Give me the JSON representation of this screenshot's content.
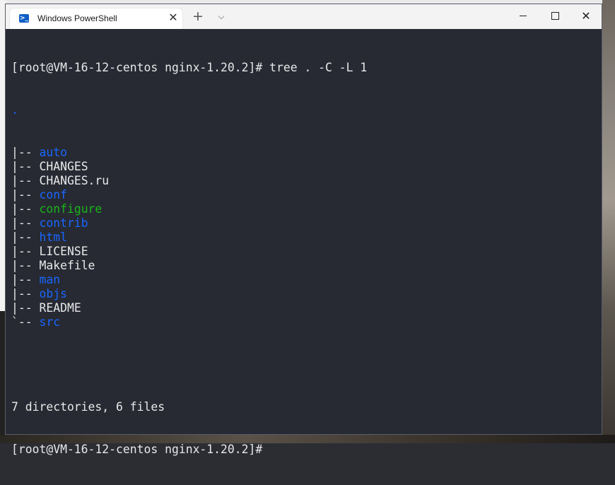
{
  "window": {
    "tab_title": "Windows PowerShell",
    "tab_icon": "powershell-icon",
    "close_tab_icon": "close-icon",
    "new_tab_icon": "plus-icon",
    "dropdown_icon": "chevron-down-icon",
    "minimize_icon": "minimize-icon",
    "maximize_icon": "maximize-icon",
    "close_icon": "close-icon"
  },
  "terminal": {
    "prompt": "[root@VM-16-12-centos nginx-1.20.2]#",
    "command": " tree . -C -L 1",
    "root_dot": ".",
    "entries": [
      {
        "prefix": "|-- ",
        "name": "auto",
        "kind": "dir"
      },
      {
        "prefix": "|-- ",
        "name": "CHANGES",
        "kind": "file"
      },
      {
        "prefix": "|-- ",
        "name": "CHANGES.ru",
        "kind": "file"
      },
      {
        "prefix": "|-- ",
        "name": "conf",
        "kind": "dir"
      },
      {
        "prefix": "|-- ",
        "name": "configure",
        "kind": "exe"
      },
      {
        "prefix": "|-- ",
        "name": "contrib",
        "kind": "dir"
      },
      {
        "prefix": "|-- ",
        "name": "html",
        "kind": "dir"
      },
      {
        "prefix": "|-- ",
        "name": "LICENSE",
        "kind": "file"
      },
      {
        "prefix": "|-- ",
        "name": "Makefile",
        "kind": "file"
      },
      {
        "prefix": "|-- ",
        "name": "man",
        "kind": "dir"
      },
      {
        "prefix": "|-- ",
        "name": "objs",
        "kind": "dir"
      },
      {
        "prefix": "|-- ",
        "name": "README",
        "kind": "file"
      },
      {
        "prefix": "`-- ",
        "name": "src",
        "kind": "dir"
      }
    ],
    "summary": "7 directories, 6 files",
    "final_prompt": "[root@VM-16-12-centos nginx-1.20.2]#"
  },
  "colors": {
    "terminal_bg": "#272a33",
    "dir": "#1a66ff",
    "exe": "#19b519",
    "text": "#e8e8e8"
  }
}
